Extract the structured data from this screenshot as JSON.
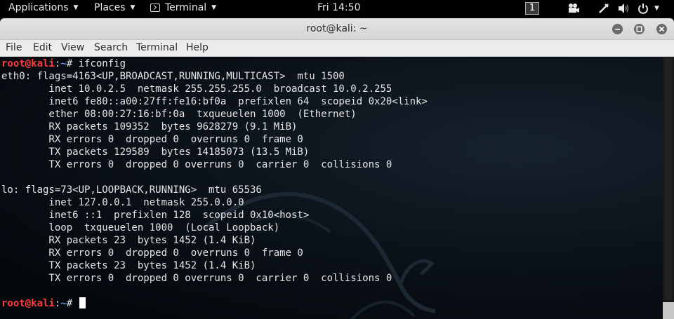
{
  "topbar": {
    "applications": "Applications",
    "places": "Places",
    "terminal": "Terminal",
    "clock": "Fri 14:50",
    "workspace": "1",
    "icons": [
      "camera-icon",
      "pen-icon",
      "volume-icon",
      "power-icon"
    ]
  },
  "window": {
    "title": "root@kali: ~",
    "menu": [
      "File",
      "Edit",
      "View",
      "Search",
      "Terminal",
      "Help"
    ]
  },
  "terminal": {
    "prompt_user": "root@kali",
    "prompt_sep": ":",
    "prompt_path": "~",
    "prompt_end": "# ",
    "command": "ifconfig",
    "output": [
      "eth0: flags=4163<UP,BROADCAST,RUNNING,MULTICAST>  mtu 1500",
      "        inet 10.0.2.5  netmask 255.255.255.0  broadcast 10.0.2.255",
      "        inet6 fe80::a00:27ff:fe16:bf0a  prefixlen 64  scopeid 0x20<link>",
      "        ether 08:00:27:16:bf:0a  txqueuelen 1000  (Ethernet)",
      "        RX packets 109352  bytes 9628279 (9.1 MiB)",
      "        RX errors 0  dropped 0  overruns 0  frame 0",
      "        TX packets 129589  bytes 14185073 (13.5 MiB)",
      "        TX errors 0  dropped 0 overruns 0  carrier 0  collisions 0",
      "",
      "lo: flags=73<UP,LOOPBACK,RUNNING>  mtu 65536",
      "        inet 127.0.0.1  netmask 255.0.0.0",
      "        inet6 ::1  prefixlen 128  scopeid 0x10<host>",
      "        loop  txqueuelen 1000  (Local Loopback)",
      "        RX packets 23  bytes 1452 (1.4 KiB)",
      "        RX errors 0  dropped 0  overruns 0  frame 0",
      "        TX packets 23  bytes 1452 (1.4 KiB)",
      "        TX errors 0  dropped 0 overruns 0  carrier 0  collisions 0",
      ""
    ]
  },
  "colors": {
    "prompt_user": "#ff3b3b",
    "prompt_path": "#5b8cff",
    "terminal_bg": "#05090e",
    "terminal_fg": "#e6e6e6"
  }
}
